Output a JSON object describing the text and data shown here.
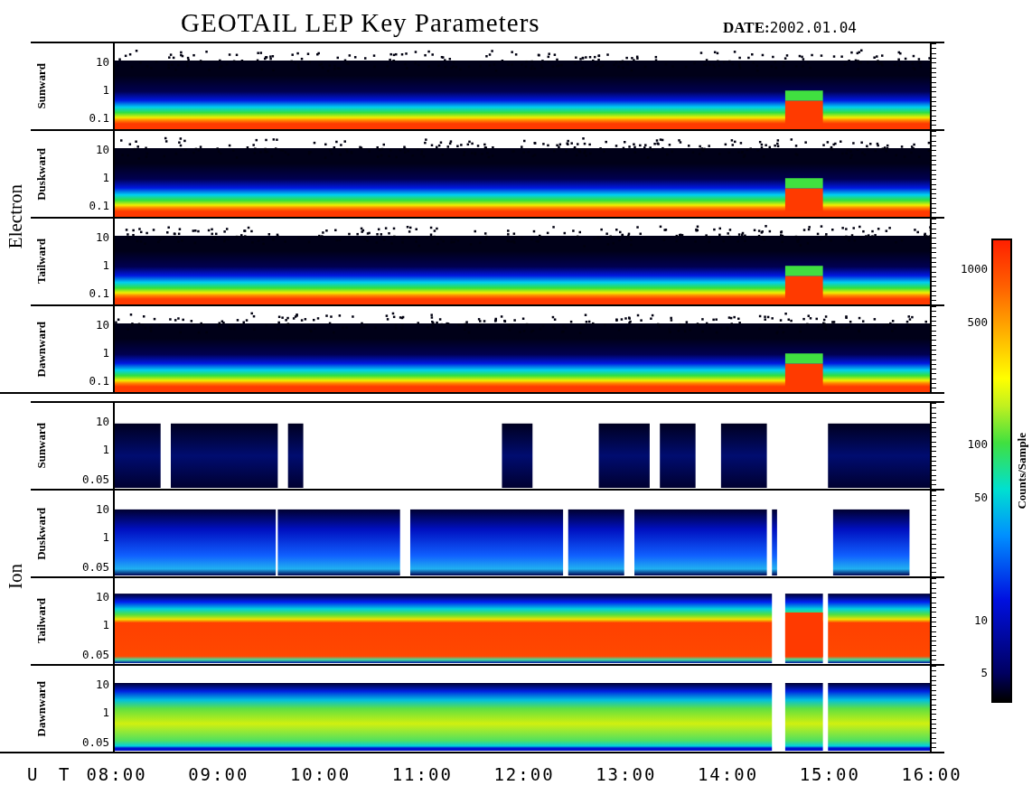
{
  "title": "GEOTAIL LEP Key Parameters",
  "date": {
    "label": "DATE:",
    "value": "2002.01.04"
  },
  "groups": [
    {
      "label": "Electron",
      "panels": [
        {
          "label": "Sunward",
          "kind": "electron",
          "yticks": [
            "10",
            "1",
            "0.1"
          ]
        },
        {
          "label": "Duskward",
          "kind": "electron",
          "yticks": [
            "10",
            "1",
            "0.1"
          ]
        },
        {
          "label": "Tailward",
          "kind": "electron",
          "yticks": [
            "10",
            "1",
            "0.1"
          ]
        },
        {
          "label": "Dawnward",
          "kind": "electron",
          "yticks": [
            "10",
            "1",
            "0.1"
          ]
        }
      ]
    },
    {
      "label": "Ion",
      "panels": [
        {
          "label": "Sunward",
          "kind": "ion",
          "yticks": [
            "10",
            "1",
            "0.05"
          ]
        },
        {
          "label": "Duskward",
          "kind": "ion",
          "yticks": [
            "10",
            "1",
            "0.05"
          ]
        },
        {
          "label": "Tailward",
          "kind": "ion",
          "yticks": [
            "10",
            "1",
            "0.05"
          ]
        },
        {
          "label": "Dawnward",
          "kind": "ion",
          "yticks": [
            "10",
            "1",
            "0.05"
          ]
        }
      ]
    }
  ],
  "time_axis": {
    "label": "U T",
    "ticks": [
      "08:00",
      "09:00",
      "10:00",
      "11:00",
      "12:00",
      "13:00",
      "14:00",
      "15:00",
      "16:00"
    ]
  },
  "colorbar": {
    "label": "Counts/Sample",
    "ticks": [
      "1000",
      "500",
      "100",
      "50",
      "10",
      "5"
    ]
  }
}
